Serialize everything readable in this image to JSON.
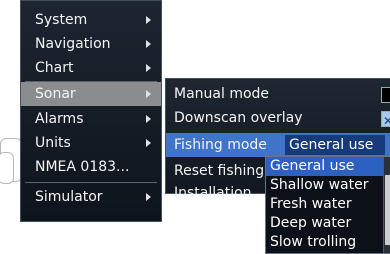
{
  "main_menu": {
    "items": [
      {
        "label": "System",
        "has_submenu": true
      },
      {
        "label": "Navigation",
        "has_submenu": true
      },
      {
        "label": "Chart",
        "has_submenu": true
      },
      {
        "label": "Sonar",
        "has_submenu": true,
        "selected": true
      },
      {
        "label": "Alarms",
        "has_submenu": true
      },
      {
        "label": "Units",
        "has_submenu": true
      },
      {
        "label": "NMEA 0183...",
        "has_submenu": false
      },
      {
        "label": "Simulator",
        "has_submenu": true
      }
    ]
  },
  "sonar_menu": {
    "manual_mode": {
      "label": "Manual mode",
      "checked": false
    },
    "downscan_overlay": {
      "label": "Downscan overlay",
      "checked": true
    },
    "fishing_mode": {
      "label": "Fishing mode",
      "value": "General use"
    },
    "reset_fishing": {
      "label": "Reset fishing"
    },
    "installation": {
      "label": "Installation..."
    }
  },
  "fishing_mode_dropdown": {
    "options": [
      "General use",
      "Shallow water",
      "Fresh water",
      "Deep water",
      "Slow trolling"
    ],
    "selected": "General use"
  },
  "colors": {
    "highlight": "#3f74c8",
    "selected_option": "#2d60c0",
    "menu_bg": "#141b24"
  }
}
